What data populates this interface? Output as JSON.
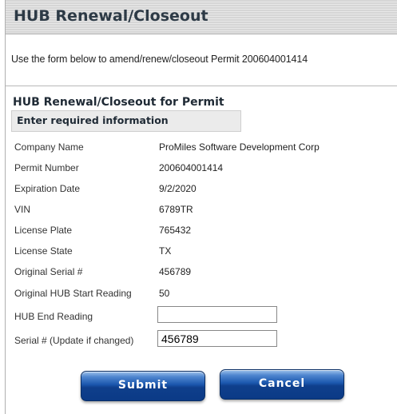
{
  "window": {
    "title": "HUB Renewal/Closeout",
    "instruction": "Use the form below to amend/renew/closeout Permit 200604001414"
  },
  "form": {
    "section_title": "HUB Renewal/Closeout for Permit",
    "subheader": "Enter required information",
    "fields": [
      {
        "label": "Company Name",
        "value": "ProMiles Software Development Corp"
      },
      {
        "label": "Permit Number",
        "value": "200604001414"
      },
      {
        "label": "Expiration Date",
        "value": "9/2/2020"
      },
      {
        "label": "VIN",
        "value": "6789TR"
      },
      {
        "label": "License Plate",
        "value": "765432"
      },
      {
        "label": "License State",
        "value": "TX"
      },
      {
        "label": "Original Serial #",
        "value": "456789"
      },
      {
        "label": "Original HUB Start Reading",
        "value": "50"
      }
    ],
    "hub_end_reading": {
      "label": "HUB End Reading",
      "value": ""
    },
    "serial_update": {
      "label": "Serial # (Update if changed)",
      "value": "456789"
    }
  },
  "buttons": {
    "submit": "Submit",
    "cancel": "Cancel"
  },
  "colors": {
    "title_text": "#2d3a46",
    "button_blue": "#1b57ad"
  }
}
